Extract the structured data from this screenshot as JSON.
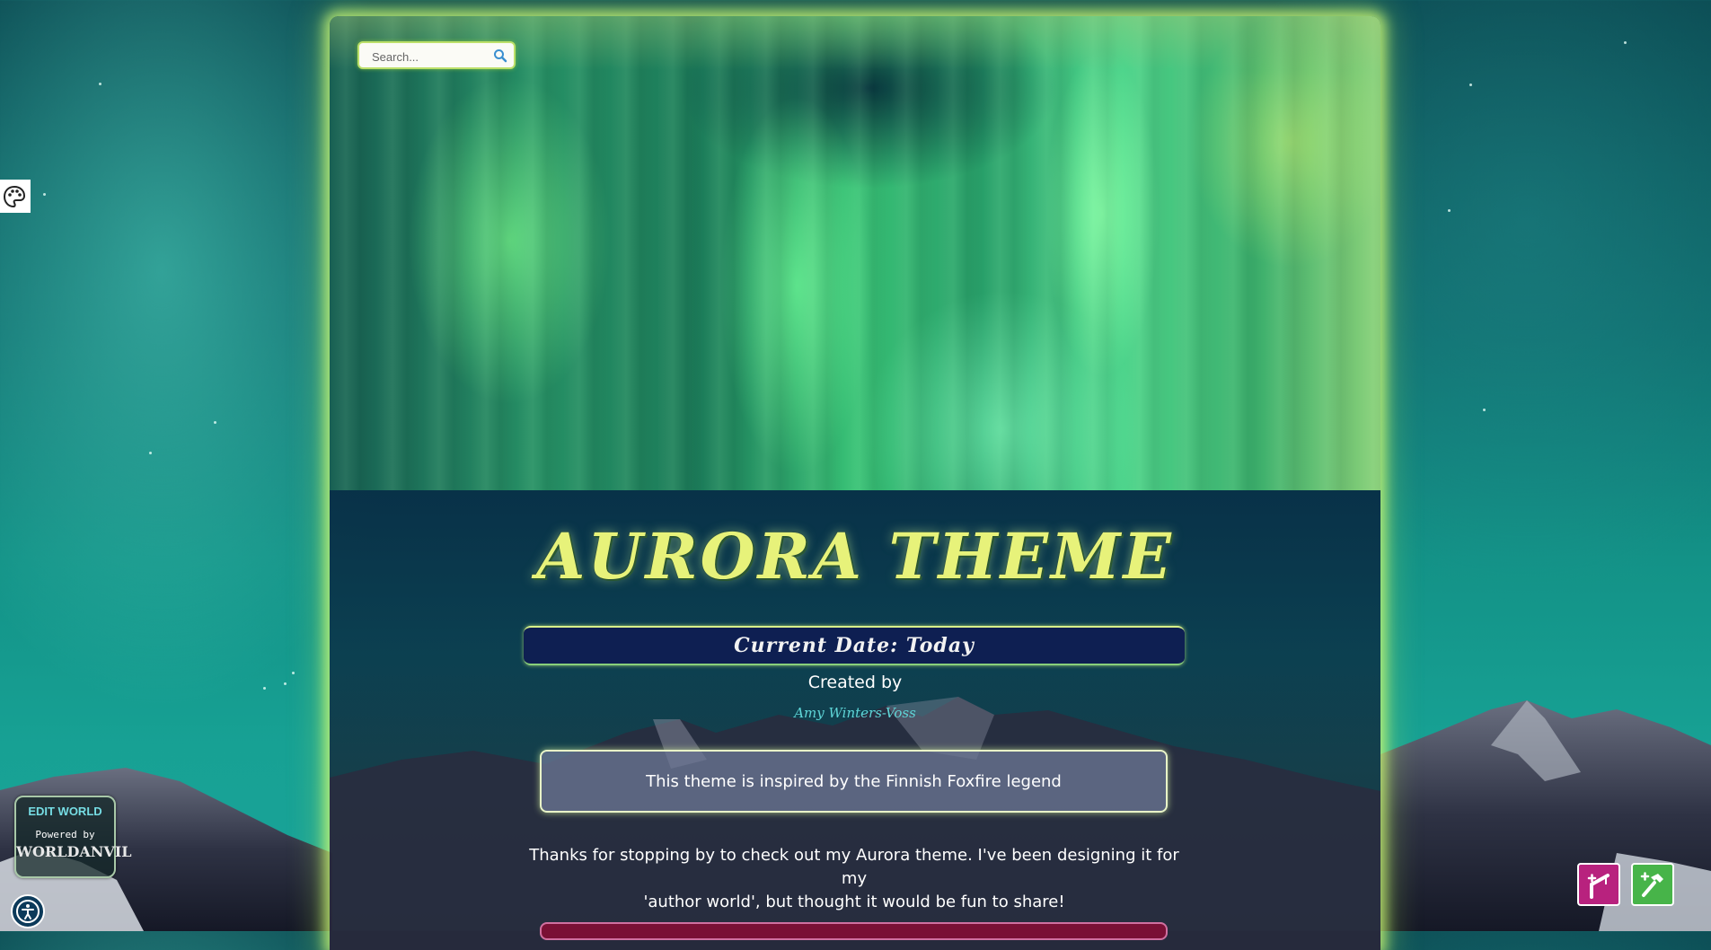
{
  "search": {
    "placeholder": "Search..."
  },
  "header": {
    "title": "AURORA THEME"
  },
  "date_bar": {
    "text": "Current Date: Today"
  },
  "credits": {
    "label": "Created by",
    "author": "Amy Winters-Voss"
  },
  "quote": {
    "text": "This theme is inspired by the Finnish Foxfire legend"
  },
  "intro": {
    "line1": "Thanks for stopping by to check out my Aurora theme. I've been designing it for my",
    "line2": "'author world', but thought it would be fun to share!"
  },
  "edit_world": {
    "link": "EDIT WORLD",
    "powered": "Powered by",
    "brand": "WORLDANVIL"
  },
  "icons": {
    "palette": "palette-icon",
    "search": "search-icon",
    "accessibility": "accessibility-icon",
    "tool_magenta": "crane-icon",
    "tool_green": "hammer-icon"
  },
  "colors": {
    "accent_glow": "#d4f77a",
    "title": "#e7f27a",
    "date_bar_bg": "#0e1f52",
    "author": "#5fd6d8",
    "tool_magenta": "#b8227e",
    "tool_green": "#47b449"
  }
}
